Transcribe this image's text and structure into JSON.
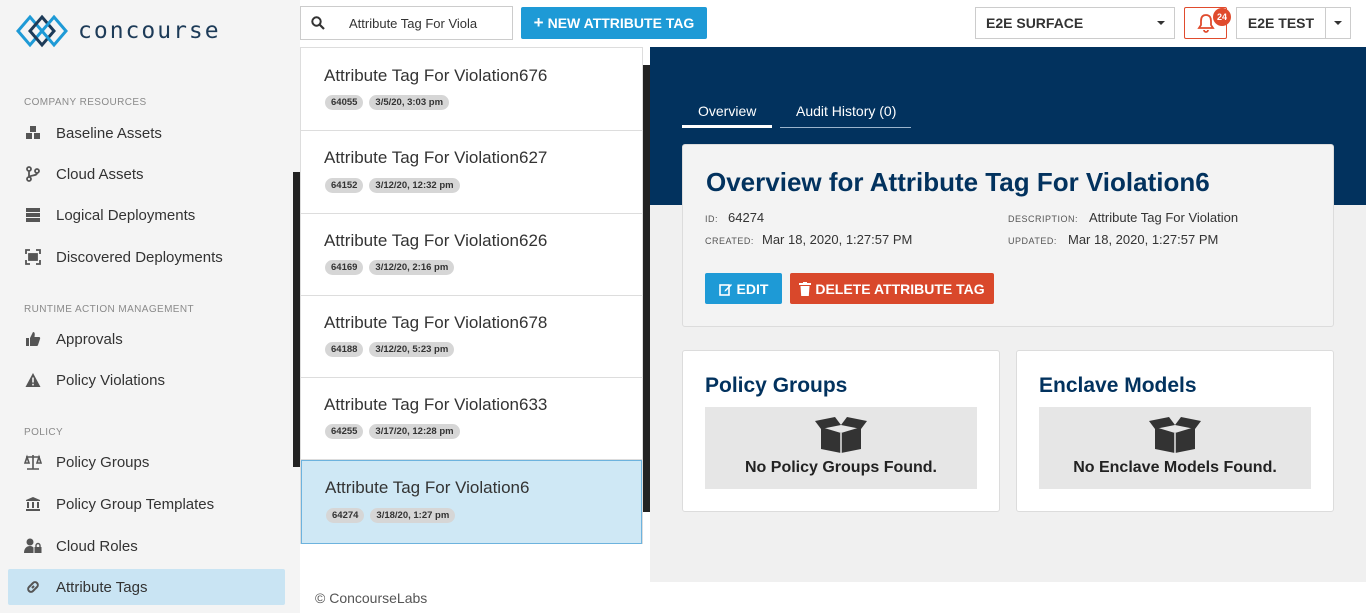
{
  "brand": {
    "name": "concourse"
  },
  "sidebar": {
    "sections": [
      {
        "title": "COMPANY RESOURCES"
      },
      {
        "title": "RUNTIME ACTION MANAGEMENT"
      },
      {
        "title": "POLICY"
      }
    ],
    "items": [
      {
        "label": "Baseline Assets",
        "icon": "cubes-icon"
      },
      {
        "label": "Cloud Assets",
        "icon": "branch-icon"
      },
      {
        "label": "Logical Deployments",
        "icon": "server-icon"
      },
      {
        "label": "Discovered Deployments",
        "icon": "scan-icon"
      },
      {
        "label": "Approvals",
        "icon": "thumbs-up-icon"
      },
      {
        "label": "Policy Violations",
        "icon": "warning-icon"
      },
      {
        "label": "Policy Groups",
        "icon": "balance-scale-icon"
      },
      {
        "label": "Policy Group Templates",
        "icon": "institution-icon"
      },
      {
        "label": "Cloud Roles",
        "icon": "user-lock-icon"
      },
      {
        "label": "Attribute Tags",
        "icon": "link-icon",
        "active": true
      }
    ]
  },
  "topbar": {
    "search_value": "Attribute Tag For Viola",
    "new_button": "NEW ATTRIBUTE TAG",
    "environment": "E2E SURFACE",
    "notifications_count": "24",
    "user": "E2E TEST"
  },
  "list": [
    {
      "title": "Attribute Tag For Violation676",
      "id": "64055",
      "date": "3/5/20, 3:03 pm"
    },
    {
      "title": "Attribute Tag For Violation627",
      "id": "64152",
      "date": "3/12/20, 12:32 pm"
    },
    {
      "title": "Attribute Tag For Violation626",
      "id": "64169",
      "date": "3/12/20, 2:16 pm"
    },
    {
      "title": "Attribute Tag For Violation678",
      "id": "64188",
      "date": "3/12/20, 5:23 pm"
    },
    {
      "title": "Attribute Tag For Violation633",
      "id": "64255",
      "date": "3/17/20, 12:28 pm"
    },
    {
      "title": "Attribute Tag For Violation6",
      "id": "64274",
      "date": "3/18/20, 1:27 pm",
      "selected": true
    }
  ],
  "tabs": [
    {
      "label": "Overview",
      "active": true
    },
    {
      "label": "Audit History (0)"
    }
  ],
  "overview": {
    "title": "Overview for Attribute Tag For Violation6",
    "id_label": "ID:",
    "id": "64274",
    "created_label": "CREATED:",
    "created": "Mar 18, 2020, 1:27:57 PM",
    "description_label": "DESCRIPTION:",
    "description": "Attribute Tag For Violation",
    "updated_label": "UPDATED:",
    "updated": "Mar 18, 2020, 1:27:57 PM",
    "edit_button": "EDIT",
    "delete_button": "DELETE ATTRIBUTE TAG"
  },
  "panels": {
    "policy_groups": {
      "title": "Policy Groups",
      "empty": "No Policy Groups Found."
    },
    "enclave_models": {
      "title": "Enclave Models",
      "empty": "No Enclave Models Found."
    }
  },
  "footer": "© ConcourseLabs",
  "colors": {
    "navy": "#02325e",
    "accent": "#1e9ad6",
    "danger": "#d9482b",
    "active_bg": "#c9e4f3"
  }
}
